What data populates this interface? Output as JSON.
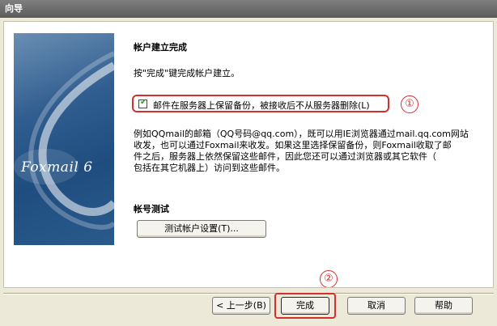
{
  "window": {
    "title": "向导"
  },
  "banner": {
    "brand": "Foxmail 6"
  },
  "main": {
    "heading": "帐户建立完成",
    "instruction": "按\"完成\"键完成帐户建立。",
    "keep_copy_checkbox": {
      "label": "邮件在服务器上保留备份，被接收后不从服务器删除(L)",
      "checked": true,
      "check_glyph": "✔"
    },
    "description_lines": [
      "例如QQmail的邮箱（QQ号码@qq.com），既可以用IE浏览器通过mail.qq.com网站",
      "收发，也可以通过Foxmail来收发。如果这里选择保留备份，则Foxmail收取了邮",
      "件之后，服务器上依然保留这些邮件，因此您还可以通过浏览器或其它软件（",
      "包括在其它机器上）访问到这些邮件。"
    ],
    "account_test": {
      "heading": "帐号测试",
      "button_label": "测试帐户设置(T)..."
    }
  },
  "annotations": {
    "callout_1": "①",
    "callout_2": "②",
    "highlight_color": "#d22f2f"
  },
  "footer": {
    "back_label": "< 上一步(B)",
    "finish_label": "完成",
    "cancel_label": "取消",
    "help_label": "帮助"
  }
}
